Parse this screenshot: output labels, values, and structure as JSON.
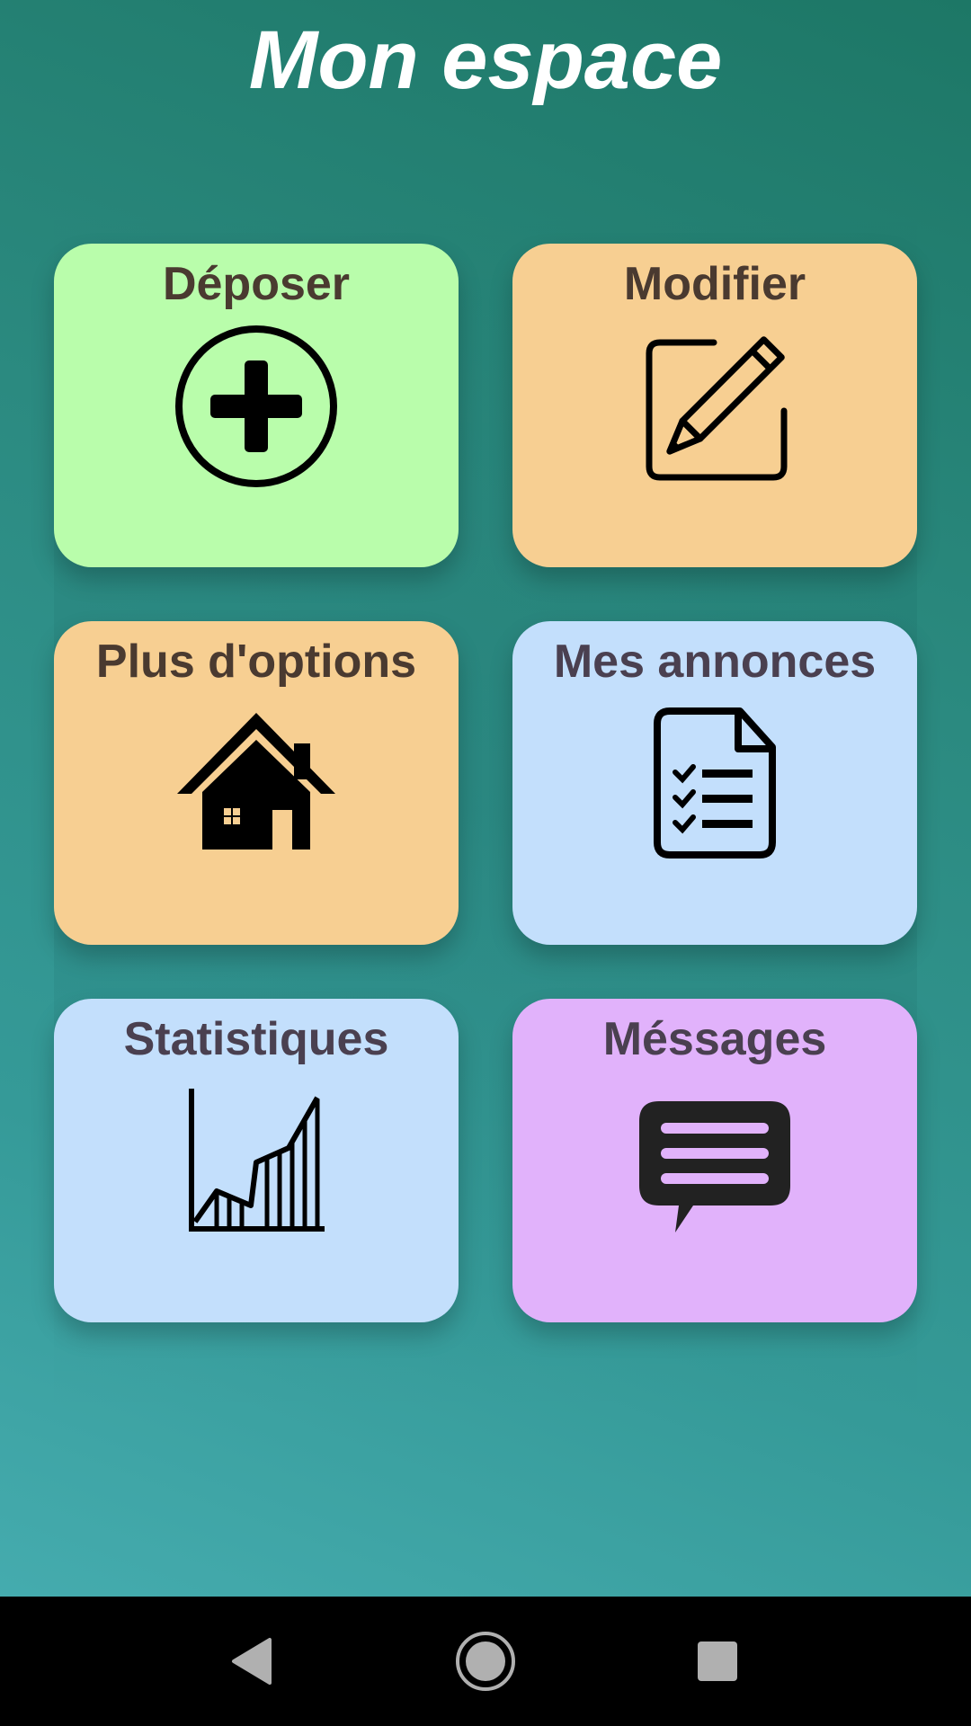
{
  "header": {
    "title": "Mon espace"
  },
  "colors": {
    "green": "#b9fdab",
    "orange": "#f7cf92",
    "blue": "#c3dffc",
    "purple": "#e1b2fb",
    "label_dark": "#4a3a30",
    "label_slate": "#4a4050"
  },
  "tiles": [
    {
      "label": "Déposer",
      "icon": "plus-circle-icon",
      "color": "#b9fdab"
    },
    {
      "label": "Modifier",
      "icon": "edit-pencil-icon",
      "color": "#f7cf92"
    },
    {
      "label": "Plus d'options",
      "icon": "house-icon",
      "color": "#f7cf92"
    },
    {
      "label": "Mes annonces",
      "icon": "checklist-document-icon",
      "color": "#c3dffc"
    },
    {
      "label": "Statistiques",
      "icon": "bar-line-chart-icon",
      "color": "#c3dffc"
    },
    {
      "label": "Méssages",
      "icon": "chat-bubble-icon",
      "color": "#e1b2fb"
    }
  ],
  "navbar": {
    "back": "back-triangle-icon",
    "home": "home-circle-icon",
    "recents": "recents-square-icon"
  }
}
